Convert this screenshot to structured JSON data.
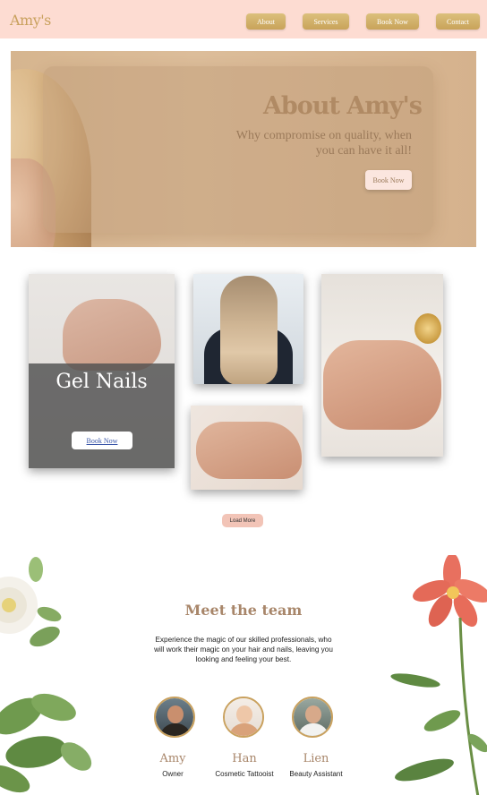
{
  "header": {
    "brand": "Amy's",
    "nav": [
      {
        "label": "About"
      },
      {
        "label": "Services"
      },
      {
        "label": "Book Now"
      },
      {
        "label": "Contact"
      }
    ]
  },
  "hero": {
    "title": "About Amy's",
    "subtitle": "Why compromise on quality, when you can have it all!",
    "cta": "Book Now"
  },
  "gallery": {
    "feature_title": "Gel Nails",
    "feature_cta": "Book Now",
    "load_more": "Load More"
  },
  "team": {
    "title": "Meet the team",
    "description": "Experience the magic of our skilled professionals, who will work their magic on your hair and nails, leaving you looking and feeling your best.",
    "members": [
      {
        "name": "Amy",
        "role": "Owner"
      },
      {
        "name": "Han",
        "role": "Cosmetic Tattooist"
      },
      {
        "name": "Lien",
        "role": "Beauty Assistant"
      }
    ]
  },
  "colors": {
    "header_bg": "#fddcd2",
    "brand_gold": "#c9a15e",
    "hero_tan": "#d6b58f",
    "accent_pink": "#f2c4b7",
    "heading_brown": "#a8866a"
  }
}
